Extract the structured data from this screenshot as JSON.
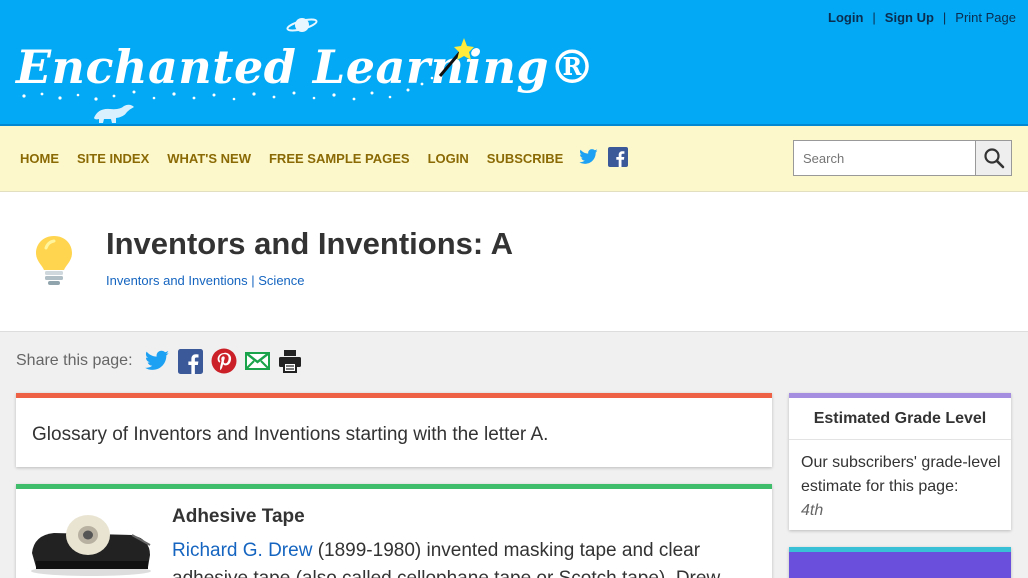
{
  "header": {
    "logo_text": "Enchanted Learning®",
    "links": {
      "login": "Login",
      "signup": "Sign Up",
      "print": "Print Page",
      "separator": "|"
    }
  },
  "nav": {
    "items": [
      "HOME",
      "SITE INDEX",
      "WHAT'S NEW",
      "FREE SAMPLE PAGES",
      "LOGIN",
      "SUBSCRIBE"
    ],
    "search_placeholder": "Search"
  },
  "title": {
    "heading": "Inventors and Inventions: A",
    "breadcrumb_1": "Inventors and Inventions",
    "breadcrumb_sep": " | ",
    "breadcrumb_2": "Science"
  },
  "share": {
    "label": "Share this page:"
  },
  "intro": {
    "text": "Glossary of Inventors and Inventions starting with the letter A."
  },
  "entry": {
    "title": "Adhesive Tape",
    "inventor": "Richard G. Drew",
    "body": " (1899-1980) invented masking tape and clear adhesive tape (also called cellophane tape or Scotch tape). Drew"
  },
  "grade": {
    "title": "Estimated Grade Level",
    "text": "Our subscribers' grade-level estimate for this page:",
    "value": "4th"
  },
  "colors": {
    "header_bg": "#03a9f4",
    "nav_bg": "#fdf8cc",
    "nav_text": "#8a6a05",
    "link": "#1565c0",
    "intro_accent": "#ee6145",
    "entry_accent": "#3fbd6a",
    "grade_accent": "#a58de0"
  },
  "icons": [
    "planet-icon",
    "dinosaur-icon",
    "magic-wand-icon",
    "twitter-icon",
    "facebook-icon",
    "search-icon",
    "lightbulb-icon",
    "pinterest-icon",
    "email-icon",
    "printer-icon"
  ]
}
